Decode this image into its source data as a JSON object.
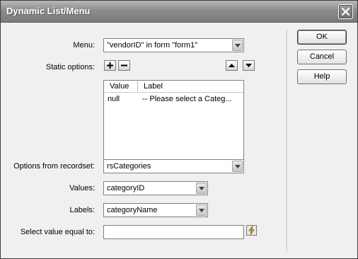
{
  "window": {
    "title": "Dynamic List/Menu"
  },
  "menu": {
    "label": "Menu:",
    "value": "\"vendorID\" in form \"form1\""
  },
  "static_options": {
    "label": "Static options:",
    "columns": [
      "Value",
      "Label"
    ],
    "rows": [
      {
        "value": "null",
        "label": "-- Please select a Categ..."
      }
    ]
  },
  "recordset": {
    "label": "Options from recordset:",
    "value": "rsCategories"
  },
  "values": {
    "label": "Values:",
    "value": "categoryID"
  },
  "labels": {
    "label": "Labels:",
    "value": "categoryName"
  },
  "select_equal": {
    "label": "Select value equal to:",
    "value": ""
  },
  "buttons": {
    "ok": "OK",
    "cancel": "Cancel",
    "help": "Help"
  }
}
